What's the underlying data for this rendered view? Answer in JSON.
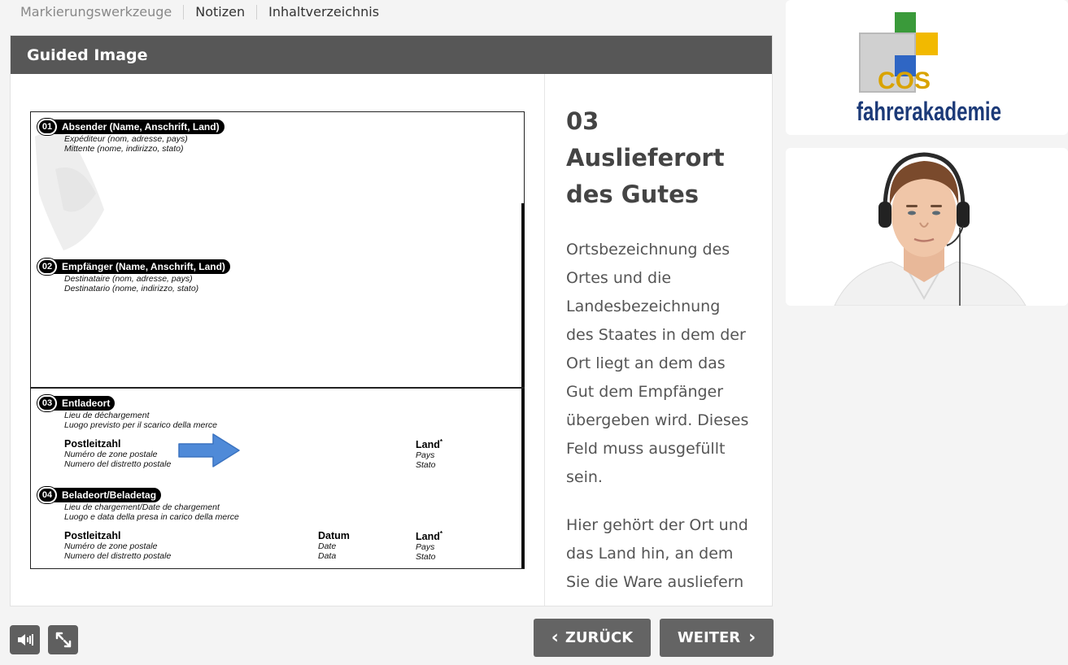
{
  "menu": {
    "items": [
      "Markierungswerkzeuge",
      "Notizen",
      "Inhaltverzeichnis"
    ]
  },
  "panel": {
    "title": "Guided Image"
  },
  "content": {
    "heading": "03 Auslieferort des Gutes",
    "paragraph1": "Ortsbezeichnung des Ortes und die Landesbezeichnung des Staates in dem der Ort liegt an dem das Gut dem Empfänger übergeben wird. Dieses Feld muss ausgefüllt sein.",
    "paragraph2": "Hier gehört der Ort und das Land hin, an dem Sie die Ware ausliefern"
  },
  "form": {
    "s01": {
      "num": "01",
      "title": "Absender (Name, Anschrift, Land)",
      "fr": "Expéditeur (nom, adresse, pays)",
      "it": "Mittente (nome, indirizzo, stato)"
    },
    "s02": {
      "num": "02",
      "title": "Empfänger (Name, Anschrift, Land)",
      "fr": "Destinataire (nom, adresse, pays)",
      "it": "Destinatario (nome, indirizzo, stato)"
    },
    "s03": {
      "num": "03",
      "title": "Entladeort",
      "fr": "Lieu de déchargement",
      "it": "Luogo previsto per il scarico della merce",
      "plz": "Postleitzahl",
      "plz_fr": "Numéro de zone postale",
      "plz_it": "Numero del distretto postale",
      "land": "Land",
      "land_fr": "Pays",
      "land_it": "Stato"
    },
    "s04": {
      "num": "04",
      "title": "Beladeort/Beladetag",
      "fr": "Lieu de chargement/Date de chargement",
      "it": "Luogo e data della presa in carico della merce",
      "plz": "Postleitzahl",
      "plz_fr": "Numéro de zone postale",
      "plz_it": "Numero del distretto postale",
      "datum": "Datum",
      "datum_fr": "Date",
      "datum_it": "Data",
      "land": "Land",
      "land_fr": "Pays",
      "land_it": "Stato"
    },
    "asterisk": "*"
  },
  "logo": {
    "cos": "COS",
    "name": "fahrerakademie"
  },
  "controls": {
    "back": "ZURÜCK",
    "next": "WEITER",
    "audio_icon": "speaker-icon",
    "fullscreen_icon": "expand-icon"
  },
  "colors": {
    "header": "#575757",
    "button": "#646464",
    "arrow": "#4f8ad8",
    "logo_text": "#1c3a78"
  }
}
